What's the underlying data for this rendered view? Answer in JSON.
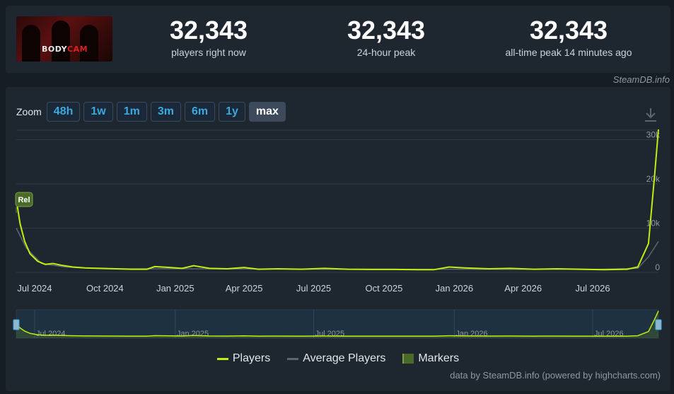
{
  "stats": [
    {
      "value": "32,343",
      "label": "players right now"
    },
    {
      "value": "32,343",
      "label": "24-hour peak"
    },
    {
      "value": "32,343",
      "label": "all-time peak 14 minutes ago"
    }
  ],
  "game_logo_text": "BODYCAM",
  "credit": "SteamDB.info",
  "zoom": {
    "label": "Zoom",
    "buttons": [
      "48h",
      "1w",
      "1m",
      "3m",
      "6m",
      "1y",
      "max"
    ],
    "active": "max"
  },
  "chart_data": {
    "type": "line",
    "x_tick_labels": [
      "Jul 2024",
      "Oct 2024",
      "Jan 2025",
      "Apr 2025",
      "Jul 2025",
      "Oct 2025",
      "Jan 2026",
      "Apr 2026",
      "Jul 2026"
    ],
    "y_tick_labels": [
      "0",
      "10k",
      "20k",
      "30k"
    ],
    "ylim": [
      0,
      32000
    ],
    "xlim": [
      "2024-06-07",
      "2026-09-25"
    ],
    "grid": true,
    "legend_position": "bottom",
    "annotations": [
      {
        "label": "Rel",
        "x": "2024-06-07"
      }
    ],
    "navigator_labels": [
      "Jul 2024",
      "Jan 2025",
      "Jul 2025",
      "Jan 2026",
      "Jul 2026"
    ],
    "series": [
      {
        "name": "Players",
        "color": "#beee11",
        "x": [
          "2024-06-07",
          "2024-06-12",
          "2024-06-18",
          "2024-06-25",
          "2024-07-05",
          "2024-07-15",
          "2024-07-25",
          "2024-08-05",
          "2024-08-20",
          "2024-09-05",
          "2024-09-25",
          "2024-10-15",
          "2024-11-05",
          "2024-11-25",
          "2024-12-05",
          "2024-12-25",
          "2025-01-10",
          "2025-01-25",
          "2025-02-15",
          "2025-03-10",
          "2025-04-01",
          "2025-04-20",
          "2025-05-15",
          "2025-06-15",
          "2025-07-15",
          "2025-08-15",
          "2025-09-15",
          "2025-10-15",
          "2025-11-15",
          "2025-12-05",
          "2025-12-25",
          "2026-01-15",
          "2026-02-15",
          "2026-03-15",
          "2026-04-15",
          "2026-05-15",
          "2026-06-15",
          "2026-07-15",
          "2026-08-15",
          "2026-08-29",
          "2026-09-12",
          "2026-09-20",
          "2026-09-25"
        ],
        "values": [
          16500,
          11000,
          7000,
          4200,
          2500,
          1800,
          2000,
          1600,
          1200,
          1000,
          900,
          800,
          700,
          700,
          1300,
          1100,
          900,
          1500,
          900,
          800,
          1100,
          700,
          800,
          700,
          900,
          700,
          650,
          650,
          600,
          600,
          1200,
          1000,
          800,
          900,
          700,
          800,
          700,
          600,
          700,
          1200,
          6500,
          22000,
          32343
        ]
      },
      {
        "name": "Average Players",
        "color": "#5c6670",
        "x": [
          "2024-06-07",
          "2024-06-20",
          "2024-07-10",
          "2024-08-10",
          "2024-10-01",
          "2025-01-01",
          "2025-07-01",
          "2026-01-01",
          "2026-07-01",
          "2026-08-29",
          "2026-09-12",
          "2026-09-25"
        ],
        "values": [
          10000,
          5500,
          2000,
          1200,
          800,
          800,
          700,
          700,
          650,
          900,
          3500,
          7000
        ]
      }
    ]
  },
  "legend": {
    "players": "Players",
    "average": "Average Players",
    "markers": "Markers"
  },
  "powered_by": "data by SteamDB.info (powered by highcharts.com)"
}
